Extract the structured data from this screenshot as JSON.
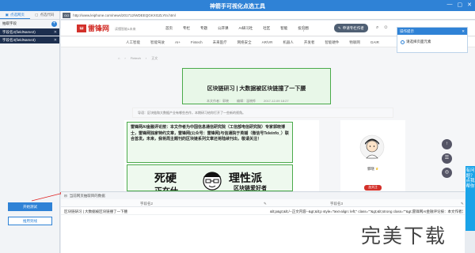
{
  "app": {
    "title": "神箭手可视化点选工具"
  },
  "sidebar": {
    "tabs": [
      "点选网页",
      "点选代码"
    ],
    "tree_title": "抽取字段",
    "fields": [
      "字段名2(fieldName2)",
      "字段名3(fieldName3)"
    ],
    "start_button": "开始测试",
    "cloud_button": "推用到线"
  },
  "browser": {
    "url_tag": "GO",
    "url": "http://www.leiphone.com/news/201712/WDEEQGKXGZLYtn.html",
    "site": {
      "logo_mark": "ꟺ",
      "logo_name": "雷锋网",
      "slogan": "读懂智能&未来",
      "nav": [
        "首页",
        "专栏",
        "专题",
        "公开课",
        "AI研习社",
        "社区",
        "智能",
        "投资圈"
      ],
      "publish": "申请专栏作者",
      "categories": [
        "人工智能",
        "智能驾驶",
        "AI+",
        "Fintech",
        "未来医疗",
        "网络安全",
        "AR/VR",
        "机器人",
        "开发者",
        "智能硬件",
        "物联网",
        "GAIR"
      ],
      "breadcrumb": [
        "Fintech",
        "正文"
      ]
    },
    "article": {
      "title": "区块链研习 | 大数据被区块链撞了一下腰",
      "meta": [
        "本文作者：郭晓",
        "编辑：温晓桦",
        "2017-12-09 18:27"
      ],
      "summary": "导语：区块链和大数据产业有哪些合作，本期研习给你打开了一些新的视角。",
      "intro": "雷锋网AI金融评论按：本文作者为中国信息通信研究院（工信部电信研究院）专家郭晓博士，雷锋网独家特约文章，雷锋网(公众号：雷锋网)与信通院于英辅（微信号Teleinfo_）联合首发。未来，我将周主题刊的区块链系列文章还将陆续刊出，敬请关注！",
      "poster_left": "死硬",
      "poster_left2": "正在什",
      "poster_right": "理性派",
      "poster_right2": "区块链爱好者"
    },
    "author": {
      "name": "郭晓",
      "follow": "加关注"
    },
    "float_buttons": [
      "↑",
      "☰",
      "◎"
    ]
  },
  "tooltip": {
    "title": "操作提示",
    "text": "请选择页面元素"
  },
  "bottom_panel": {
    "header": "当前网页抽取目的数据",
    "columns": [
      "字段名2",
      "字段名3"
    ],
    "rows": [
      [
        "区块链研习 | 大数据被区块链撞了一下腰",
        "&lt;p&gt;&lt;/--正文内容--&gt;&lt;p style=\"text-align: left;\" class=\"\"&gt;&lt;strong class=\"\"&gt;雷锋网AI金融评论按：本文作者为中国信"
      ]
    ]
  },
  "side_tab": "有问题？点我帮你",
  "watermark": "完美下载"
}
